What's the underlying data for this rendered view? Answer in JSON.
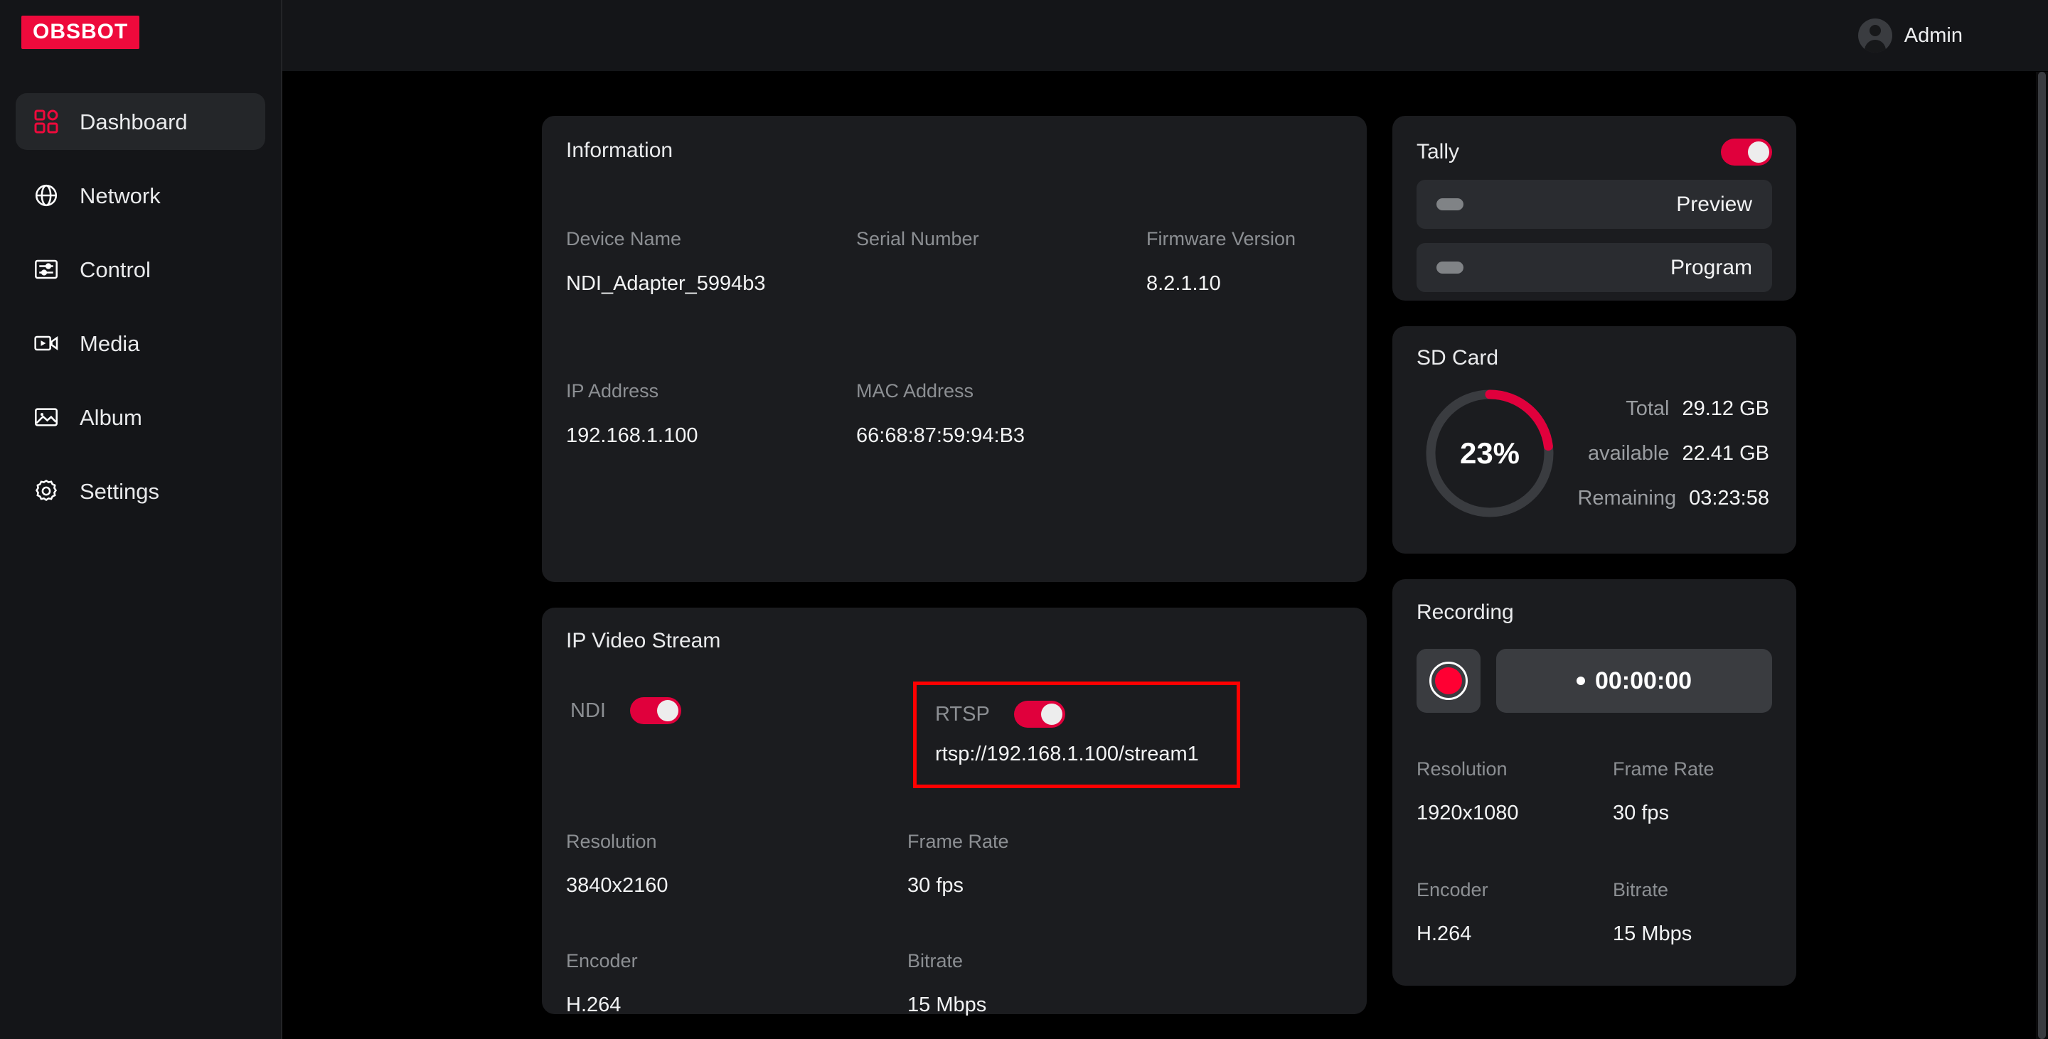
{
  "brand": {
    "logo_text": "OBSBOT"
  },
  "sidebar": {
    "items": [
      {
        "label": "Dashboard",
        "icon": "grid-icon",
        "active": true
      },
      {
        "label": "Network",
        "icon": "globe-icon",
        "active": false
      },
      {
        "label": "Control",
        "icon": "sliders-icon",
        "active": false
      },
      {
        "label": "Media",
        "icon": "video-camera-icon",
        "active": false
      },
      {
        "label": "Album",
        "icon": "image-icon",
        "active": false
      },
      {
        "label": "Settings",
        "icon": "gear-icon",
        "active": false
      }
    ]
  },
  "topbar": {
    "user_name": "Admin",
    "avatar_icon": "user-avatar-icon"
  },
  "information": {
    "title": "Information",
    "device_name_label": "Device Name",
    "device_name_value": "NDI_Adapter_5994b3",
    "serial_number_label": "Serial Number",
    "serial_number_value": "",
    "firmware_version_label": "Firmware Version",
    "firmware_version_value": "8.2.1.10",
    "ip_address_label": "IP Address",
    "ip_address_value": "192.168.1.100",
    "mac_address_label": "MAC Address",
    "mac_address_value": "66:68:87:59:94:B3"
  },
  "tally": {
    "title": "Tally",
    "enabled": true,
    "rows": [
      {
        "label": "Preview",
        "indicator": "off"
      },
      {
        "label": "Program",
        "indicator": "off"
      }
    ]
  },
  "sd_card": {
    "title": "SD Card",
    "percent_label": "23%",
    "percent_value": 23,
    "total_label": "Total",
    "total_value": "29.12 GB",
    "available_label": "available",
    "available_value": "22.41 GB",
    "remaining_label": "Remaining",
    "remaining_value": "03:23:58"
  },
  "ip_video_stream": {
    "title": "IP Video Stream",
    "ndi_label": "NDI",
    "ndi_enabled": true,
    "rtsp_label": "RTSP",
    "rtsp_enabled": true,
    "rtsp_url": "rtsp://192.168.1.100/stream1",
    "resolution_label": "Resolution",
    "resolution_value": "3840x2160",
    "frame_rate_label": "Frame Rate",
    "frame_rate_value": "30 fps",
    "encoder_label": "Encoder",
    "encoder_value": "H.264",
    "bitrate_label": "Bitrate",
    "bitrate_value": "15 Mbps"
  },
  "recording": {
    "title": "Recording",
    "record_button_icon": "record-circle-icon",
    "timer_value": "00:00:00",
    "resolution_label": "Resolution",
    "resolution_value": "1920x1080",
    "frame_rate_label": "Frame Rate",
    "frame_rate_value": "30 fps",
    "encoder_label": "Encoder",
    "encoder_value": "H.264",
    "bitrate_label": "Bitrate",
    "bitrate_value": "15 Mbps"
  },
  "colors": {
    "brand_red": "#EE0A3C",
    "toggle_red": "#E0003C",
    "highlight_red": "#FF0000",
    "record_red": "#FF0033",
    "card_bg": "#1B1C1F",
    "page_bg": "#000000",
    "sidebar_bg": "#141518"
  }
}
